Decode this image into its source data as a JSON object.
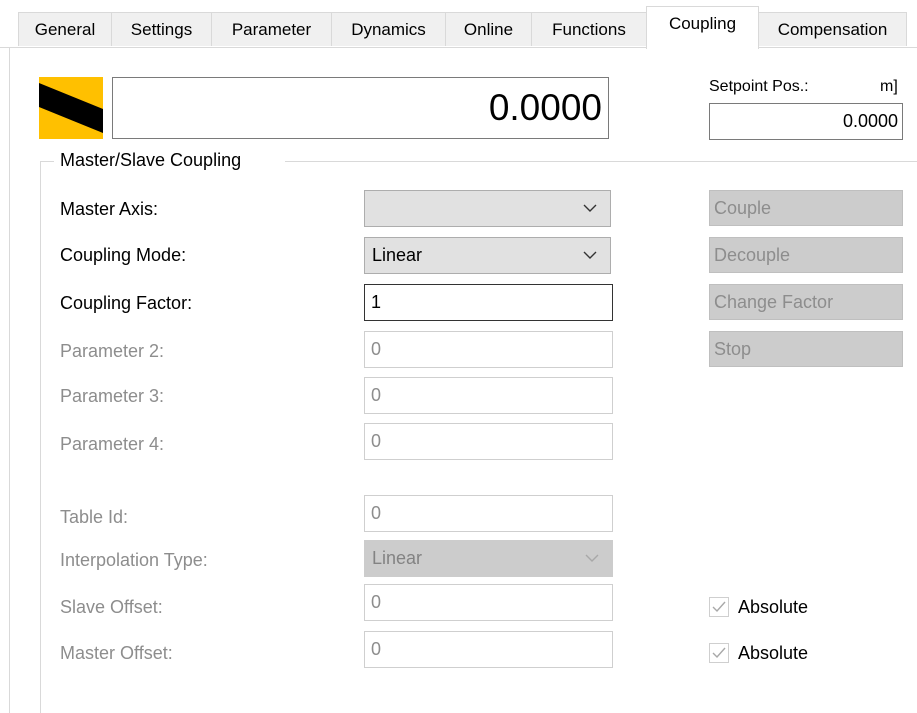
{
  "tabs": [
    {
      "label": "General"
    },
    {
      "label": "Settings"
    },
    {
      "label": "Parameter"
    },
    {
      "label": "Dynamics"
    },
    {
      "label": "Online"
    },
    {
      "label": "Functions"
    },
    {
      "label": "Coupling",
      "active": true
    },
    {
      "label": "Compensation"
    }
  ],
  "position_display": {
    "value": "0.0000",
    "icon": "axis-status-stripe-icon"
  },
  "setpoint": {
    "label": "Setpoint Pos.:",
    "unit": "m]",
    "value": "0.0000"
  },
  "group": {
    "title": "Master/Slave Coupling"
  },
  "fields": {
    "master_axis": {
      "label": "Master Axis:",
      "value": ""
    },
    "coupling_mode": {
      "label": "Coupling Mode:",
      "value": "Linear"
    },
    "coupling_factor": {
      "label": "Coupling Factor:",
      "value": "1"
    },
    "parameter_2": {
      "label": "Parameter 2:",
      "value": "0"
    },
    "parameter_3": {
      "label": "Parameter 3:",
      "value": "0"
    },
    "parameter_4": {
      "label": "Parameter 4:",
      "value": "0"
    },
    "table_id": {
      "label": "Table Id:",
      "value": "0"
    },
    "interpolation_type": {
      "label": "Interpolation Type:",
      "value": "Linear"
    },
    "slave_offset": {
      "label": "Slave Offset:",
      "value": "0"
    },
    "master_offset": {
      "label": "Master Offset:",
      "value": "0"
    }
  },
  "buttons": {
    "couple": "Couple",
    "decouple": "Decouple",
    "change_factor": "Change Factor",
    "stop": "Stop"
  },
  "checkboxes": {
    "slave_absolute": {
      "label": "Absolute",
      "checked": true,
      "enabled": false
    },
    "master_absolute": {
      "label": "Absolute",
      "checked": true,
      "enabled": false
    }
  },
  "colors": {
    "disabled_text": "#8d8d8d",
    "disabled_bg": "#cccccc",
    "icon_yellow": "#ffc000"
  }
}
